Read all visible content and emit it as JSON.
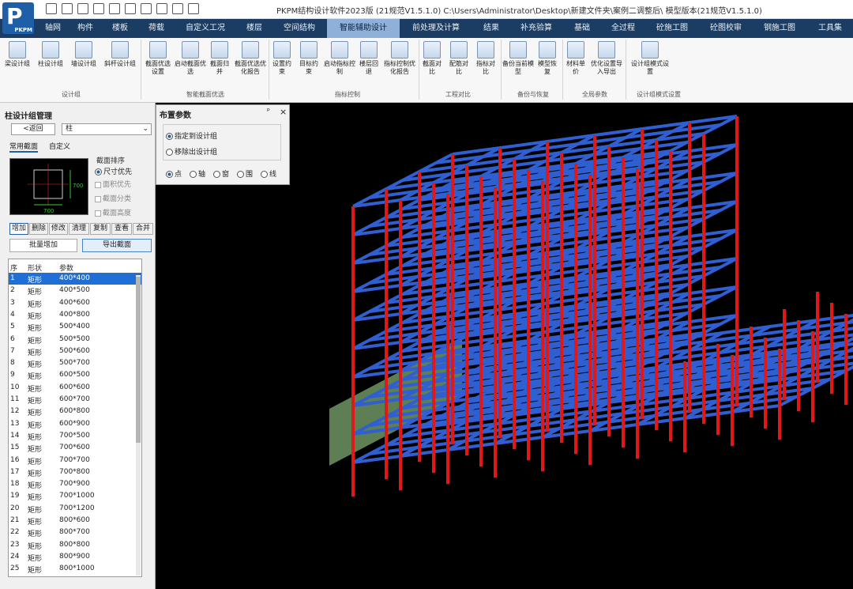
{
  "title": "PKPM结构设计软件2023版 (21规范V1.5.1.0) C:\\Users\\Administrator\\Desktop\\新建文件夹\\案例二调整后\\ 模型版本(21规范V1.5.1.0)",
  "logo_text": "P",
  "logo_sub": "PKPM",
  "menu_tabs": [
    "轴网",
    "构件",
    "楼板",
    "荷载",
    "自定义工况",
    "楼层",
    "空间结构",
    "智能辅助设计",
    "前处理及计算",
    "结果",
    "补充验算",
    "基础",
    "全过程",
    "砼施工图",
    "砼图校审",
    "钢施工图",
    "工具集"
  ],
  "ribbon": {
    "buttons": [
      "梁设计组",
      "柱设计组",
      "墙设计组",
      "斜杆设计组",
      "截面优选设置",
      "启动截面优选",
      "截面归并",
      "截面优选优化报告",
      "设置约束",
      "目标约束",
      "启动指标控制",
      "楼层回退",
      "指标控制优化报告",
      "截面对比",
      "配筋对比",
      "指标对比",
      "备份当前模型",
      "模型恢复",
      "材料单价",
      "优化设置导入导出",
      "设计组模式设置"
    ],
    "groups": [
      "设计组",
      "智能截面优选",
      "指标控制",
      "工程对比",
      "备份与恢复",
      "全局参数",
      "设计组模式设置"
    ]
  },
  "left_panel": {
    "title": "柱设计组管理",
    "back_button": "<返回",
    "type_select": "柱",
    "tabs": [
      "常用截面",
      "自定义"
    ],
    "sort_title": "截面排序",
    "sort_options": [
      "尺寸优先",
      "面积优先",
      "截面分类",
      "截面高度"
    ],
    "dims": [
      "700",
      "700"
    ],
    "action_tabs": [
      "增加",
      "删除",
      "修改",
      "清理",
      "复制",
      "查看",
      "合并"
    ],
    "batch_button": "批量增加",
    "import_button": "导出截面",
    "list_headers": [
      "序",
      "形状",
      "参数"
    ],
    "shape": "矩形",
    "rows": [
      {
        "n": "1",
        "p": "400*400"
      },
      {
        "n": "2",
        "p": "400*500"
      },
      {
        "n": "3",
        "p": "400*600"
      },
      {
        "n": "4",
        "p": "400*800"
      },
      {
        "n": "5",
        "p": "500*400"
      },
      {
        "n": "6",
        "p": "500*500"
      },
      {
        "n": "7",
        "p": "500*600"
      },
      {
        "n": "8",
        "p": "500*700"
      },
      {
        "n": "9",
        "p": "600*500"
      },
      {
        "n": "10",
        "p": "600*600"
      },
      {
        "n": "11",
        "p": "600*700"
      },
      {
        "n": "12",
        "p": "600*800"
      },
      {
        "n": "13",
        "p": "600*900"
      },
      {
        "n": "14",
        "p": "700*500"
      },
      {
        "n": "15",
        "p": "700*600"
      },
      {
        "n": "16",
        "p": "700*700"
      },
      {
        "n": "17",
        "p": "700*800"
      },
      {
        "n": "18",
        "p": "700*900"
      },
      {
        "n": "19",
        "p": "700*1000"
      },
      {
        "n": "20",
        "p": "700*1200"
      },
      {
        "n": "21",
        "p": "800*600"
      },
      {
        "n": "22",
        "p": "800*700"
      },
      {
        "n": "23",
        "p": "800*800"
      },
      {
        "n": "24",
        "p": "800*900"
      },
      {
        "n": "25",
        "p": "800*1000"
      }
    ]
  },
  "float_panel": {
    "title": "布置参数",
    "options": [
      "指定到设计组",
      "移除出设计组"
    ],
    "modes": [
      "点",
      "轴",
      "窗",
      "围",
      "线"
    ],
    "pin": "ᵖ",
    "close": "×"
  },
  "colors": {
    "beam": "#2f5fd0",
    "column": "#e01818",
    "shear_wall": "#9bd48a",
    "background": "#000000",
    "menubar": "#1c3d63"
  }
}
